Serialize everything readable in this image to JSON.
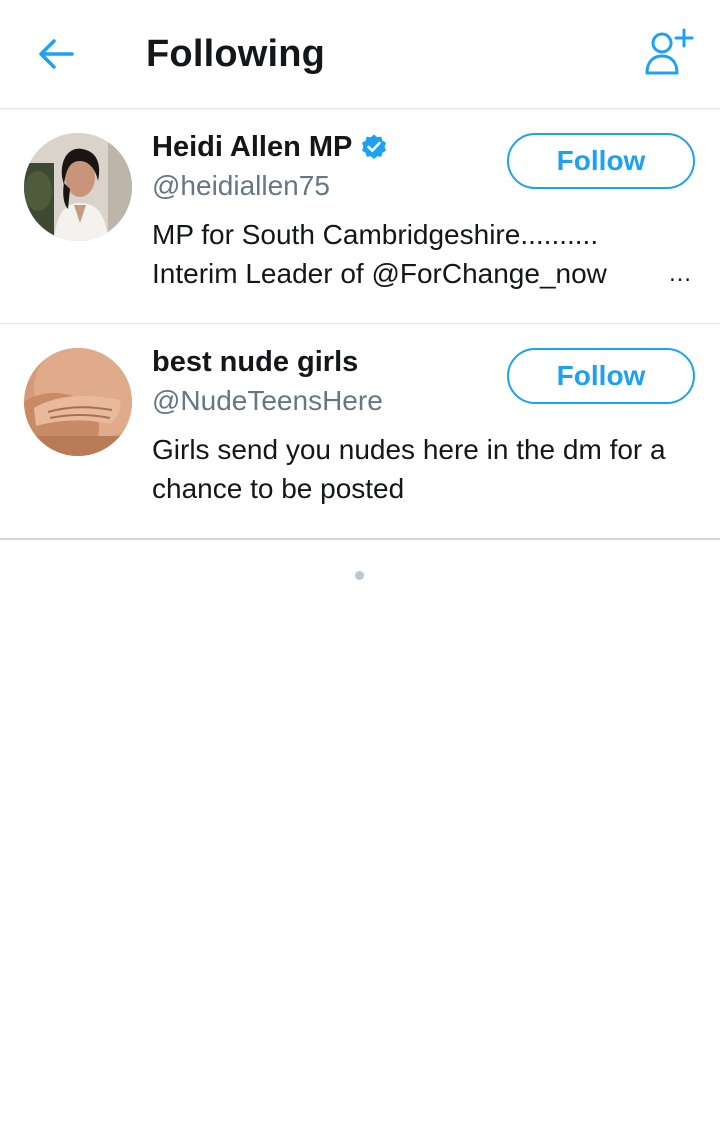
{
  "header": {
    "title": "Following",
    "back_icon": "arrow-left-icon",
    "add_icon": "add-user-icon",
    "accent": "#1da1f2"
  },
  "users": [
    {
      "name": "Heidi Allen MP",
      "verified": true,
      "handle": "@heidiallen75",
      "bio_lines": [
        "MP for South Cambridgeshire..........",
        "Interim Leader of @ForChange_now"
      ],
      "bio_truncated": "…",
      "follow_label": "Follow"
    },
    {
      "name": "best nude girls",
      "verified": false,
      "handle": "@NudeTeensHere",
      "bio_lines": [
        "Girls send you nudes here in the dm for a",
        "chance to be posted"
      ],
      "follow_label": "Follow"
    }
  ],
  "colors": {
    "accent": "#1da1f2",
    "secondary_text": "#657786",
    "divider": "#e1e8ed"
  }
}
